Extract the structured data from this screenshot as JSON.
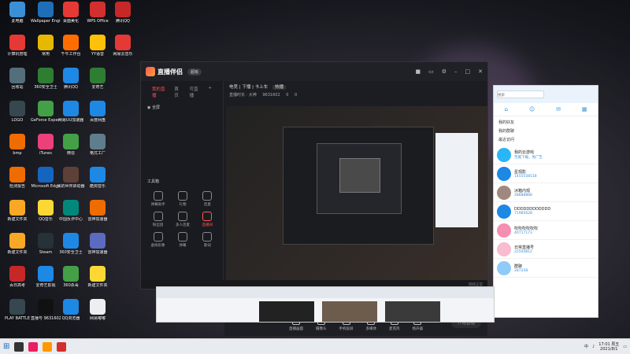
{
  "desktop": {
    "icons": [
      {
        "label": "此电脑",
        "color": "#3a8fd6"
      },
      {
        "label": "Wallpaper Engine:...",
        "color": "#1e6fb8"
      },
      {
        "label": "桌面美化",
        "color": "#e53935"
      },
      {
        "label": "WPS Office",
        "color": "#d32f2f"
      },
      {
        "label": "腾讯QQ",
        "color": "#c62828"
      },
      {
        "label": "计算机管理",
        "color": "#e53935"
      },
      {
        "label": "常用",
        "color": "#e6b800"
      },
      {
        "label": "千牛工作台",
        "color": "#ff6d00"
      },
      {
        "label": "YY语音",
        "color": "#ffc107"
      },
      {
        "label": "网易云音乐",
        "color": "#e53935"
      },
      {
        "label": "回收站",
        "color": "#546e7a"
      },
      {
        "label": "360安全卫士",
        "color": "#2e7d32"
      },
      {
        "label": "腾讯QQ",
        "color": "#1e88e5"
      },
      {
        "label": "爱奇艺",
        "color": "#2e7d32"
      },
      {
        "label": "LOGO",
        "color": "#37474f"
      },
      {
        "label": "GeForce Experience",
        "color": "#43a047"
      },
      {
        "label": "网易UU加速器",
        "color": "#1e88e5"
      },
      {
        "label": "百度网盘",
        "color": "#1e88e5"
      },
      {
        "label": "bmp",
        "color": "#ef6c00"
      },
      {
        "label": "iTunes",
        "color": "#ec407a"
      },
      {
        "label": "微信",
        "color": "#43a047"
      },
      {
        "label": "格式工厂",
        "color": "#607d8b"
      },
      {
        "label": "检测报告",
        "color": "#ef6c00"
      },
      {
        "label": "Microsoft Edge",
        "color": "#1565c0"
      },
      {
        "label": "我的世界启动器",
        "color": "#5d4037"
      },
      {
        "label": "酷狗音乐",
        "color": "#1e88e5"
      },
      {
        "label": "新建文件夹",
        "color": "#f9a825"
      },
      {
        "label": "QQ音乐",
        "color": "#fdd835"
      },
      {
        "label": "中国反诈中心",
        "color": "#00897b"
      },
      {
        "label": "雷神加速器",
        "color": "#ef6c00"
      },
      {
        "label": "新建文件夹",
        "color": "#f9a825"
      },
      {
        "label": "Steam",
        "color": "#263238"
      },
      {
        "label": "360安全卫士",
        "color": "#1e88e5"
      },
      {
        "label": "雷神加速器",
        "color": "#5c6bc0"
      },
      {
        "label": "百日高考",
        "color": "#c62828"
      },
      {
        "label": "爱奇艺影视",
        "color": "#1e88e5"
      },
      {
        "label": "360杀毒",
        "color": "#43a047"
      },
      {
        "label": "新建文件夹",
        "color": "#fdd835"
      },
      {
        "label": "PLAY BATTLE",
        "color": "#37474f"
      },
      {
        "label": "直播号 9631602",
        "color": "#111111"
      },
      {
        "label": "QQ浏览器",
        "color": "#1e88e5"
      },
      {
        "label": "网易嘟嘟",
        "color": "#eceff1"
      }
    ]
  },
  "app": {
    "name": "直播伴侣",
    "version_badge": "超级",
    "sidebar_tabs": [
      "我的直播",
      "首页",
      "可直播"
    ],
    "scene_label": "全屏",
    "tools_title": "工具箱",
    "tools": [
      {
        "label": "弹幕助手"
      },
      {
        "label": "礼物"
      },
      {
        "label": "连麦"
      },
      {
        "label": "粉丝团"
      },
      {
        "label": "多人连麦"
      },
      {
        "label": "直播间"
      },
      {
        "label": "虚拟形象"
      },
      {
        "label": "弹幕"
      },
      {
        "label": "歌词"
      }
    ],
    "header_title": "电竞 | 下播 | 卡上车",
    "header_tag": "热播",
    "header_meta": "直播时长 · 大神",
    "viewers": "9631602",
    "likes": "0",
    "shares": "0",
    "bottom_actions": [
      "直播画面",
      "摄像头",
      "手机投屏",
      "多媒体",
      "麦克风",
      "扬声器"
    ],
    "start_button": "开始直播",
    "status_left": "如何使用手机投屏摄像头",
    "status_right": "网络正常"
  },
  "chat_panel": {
    "search_placeholder": "搜索",
    "groups": [
      "我的好友",
      "我的群聊",
      "最近访问"
    ],
    "rows": [
      {
        "name": "我的云游戏",
        "sub": "无痕下载，免广告",
        "color": "#29b6f6"
      },
      {
        "name": "星观影",
        "sub": "1455558518",
        "color": "#1e88e5"
      },
      {
        "name": "冰箱内观",
        "sub": "28888888",
        "color": "#a1887f"
      },
      {
        "name": "DDDDDDDDDDDD",
        "sub": "71985628",
        "color": "#1e88e5"
      },
      {
        "name": "吹吹吹吹吹吹",
        "sub": "40717173",
        "color": "#f48fb1"
      },
      {
        "name": "日常直播号",
        "sub": "25504812",
        "color": "#f8bbd0"
      },
      {
        "name": "群聊",
        "sub": "287258",
        "color": "#90caf9"
      }
    ]
  },
  "taskbar": {
    "time": "17:01 周五",
    "date": "2021/8/1",
    "ime": "中"
  }
}
